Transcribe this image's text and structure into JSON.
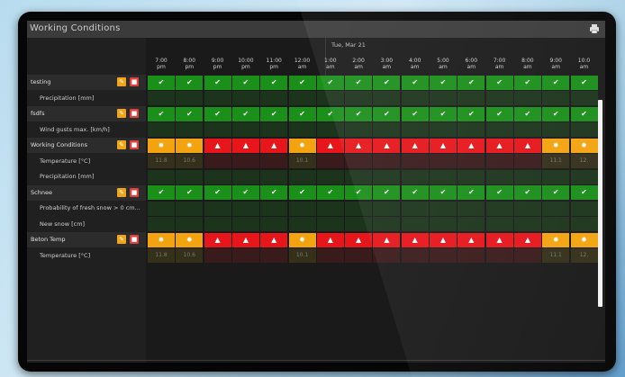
{
  "window": {
    "title": "Working Conditions",
    "print_icon": "printer-icon"
  },
  "date_label": "Tue, Mar 21",
  "hours": [
    {
      "t": "7:00",
      "p": "pm"
    },
    {
      "t": "8:00",
      "p": "pm"
    },
    {
      "t": "9:00",
      "p": "pm"
    },
    {
      "t": "10:00",
      "p": "pm"
    },
    {
      "t": "11:00",
      "p": "pm"
    },
    {
      "t": "12:00",
      "p": "am"
    },
    {
      "t": "1:00",
      "p": "am"
    },
    {
      "t": "2:00",
      "p": "am"
    },
    {
      "t": "3:00",
      "p": "am"
    },
    {
      "t": "4:00",
      "p": "am"
    },
    {
      "t": "5:00",
      "p": "am"
    },
    {
      "t": "6:00",
      "p": "am"
    },
    {
      "t": "7:00",
      "p": "am"
    },
    {
      "t": "8:00",
      "p": "am"
    },
    {
      "t": "9:00",
      "p": "am"
    },
    {
      "t": "10:0",
      "p": "am"
    }
  ],
  "rows": [
    {
      "kind": "head",
      "label": "testing",
      "cells": [
        "g",
        "g",
        "g",
        "g",
        "g",
        "g",
        "g",
        "g",
        "g",
        "g",
        "g",
        "g",
        "g",
        "g",
        "g",
        "g"
      ]
    },
    {
      "kind": "sub",
      "label": "Precipitation [mm]",
      "cells": [
        "dg",
        "dg",
        "dg",
        "dg",
        "dg",
        "dg",
        "dg",
        "dg",
        "dg",
        "dg",
        "dg",
        "dg",
        "dg",
        "dg",
        "dg",
        "dg"
      ],
      "values": [
        "",
        "",
        "",
        "",
        "",
        "",
        "",
        "",
        "",
        "",
        "",
        "",
        "",
        "",
        "",
        ""
      ]
    },
    {
      "kind": "head",
      "label": "fsdfs",
      "cells": [
        "g",
        "g",
        "g",
        "g",
        "g",
        "g",
        "g",
        "g",
        "g",
        "g",
        "g",
        "g",
        "g",
        "g",
        "g",
        "g"
      ]
    },
    {
      "kind": "sub",
      "label": "Wind gusts max. [km/h]",
      "cells": [
        "dg",
        "dg",
        "dg",
        "dg",
        "dg",
        "dg",
        "dg",
        "dg",
        "dg",
        "dg",
        "dg",
        "dg",
        "dg",
        "dg",
        "dg",
        "dg"
      ],
      "values": [
        "",
        "",
        "",
        "",
        "",
        "",
        "",
        "",
        "",
        "",
        "",
        "",
        "",
        "",
        "",
        ""
      ]
    },
    {
      "kind": "head",
      "label": "Working Conditions",
      "cells": [
        "o",
        "o",
        "r",
        "r",
        "r",
        "o",
        "r",
        "r",
        "r",
        "r",
        "r",
        "r",
        "r",
        "r",
        "o",
        "o"
      ]
    },
    {
      "kind": "sub",
      "label": "Temperature [°C]",
      "cells": [
        "dy",
        "dy",
        "dr",
        "dr",
        "dr",
        "dy",
        "dr",
        "dr",
        "dr",
        "dr",
        "dr",
        "dr",
        "dr",
        "dr",
        "dy",
        "dy"
      ],
      "values": [
        "11.8",
        "10.6",
        "",
        "",
        "",
        "10.1",
        "",
        "",
        "",
        "",
        "",
        "",
        "",
        "",
        "11.1",
        "12."
      ]
    },
    {
      "kind": "sub",
      "label": "Precipitation [mm]",
      "cells": [
        "dg",
        "dg",
        "dg",
        "dg",
        "dg",
        "dg",
        "dg",
        "dg",
        "dg",
        "dg",
        "dg",
        "dg",
        "dg",
        "dg",
        "dg",
        "dg"
      ],
      "values": [
        "",
        "",
        "",
        "",
        "",
        "",
        "",
        "",
        "",
        "",
        "",
        "",
        "",
        "",
        "",
        ""
      ]
    },
    {
      "kind": "head",
      "label": "Schnee",
      "cells": [
        "g",
        "g",
        "g",
        "g",
        "g",
        "g",
        "g",
        "g",
        "g",
        "g",
        "g",
        "g",
        "g",
        "g",
        "g",
        "g"
      ]
    },
    {
      "kind": "sub",
      "label": "Probability of fresh snow > 0 cm...",
      "cells": [
        "dg",
        "dg",
        "dg",
        "dg",
        "dg",
        "dg",
        "dg",
        "dg",
        "dg",
        "dg",
        "dg",
        "dg",
        "dg",
        "dg",
        "dg",
        "dg"
      ],
      "values": [
        "",
        "",
        "",
        "",
        "",
        "",
        "",
        "",
        "",
        "",
        "",
        "",
        "",
        "",
        "",
        ""
      ]
    },
    {
      "kind": "sub",
      "label": "New snow [cm]",
      "cells": [
        "dg",
        "dg",
        "dg",
        "dg",
        "dg",
        "dg",
        "dg",
        "dg",
        "dg",
        "dg",
        "dg",
        "dg",
        "dg",
        "dg",
        "dg",
        "dg"
      ],
      "values": [
        "",
        "",
        "",
        "",
        "",
        "",
        "",
        "",
        "",
        "",
        "",
        "",
        "",
        "",
        "",
        ""
      ]
    },
    {
      "kind": "head",
      "label": "Beton Temp",
      "cells": [
        "o",
        "o",
        "r",
        "r",
        "r",
        "o",
        "r",
        "r",
        "r",
        "r",
        "r",
        "r",
        "r",
        "r",
        "o",
        "o"
      ]
    },
    {
      "kind": "sub",
      "label": "Temperature [°C]",
      "cells": [
        "dy",
        "dy",
        "dr",
        "dr",
        "dr",
        "dy",
        "dr",
        "dr",
        "dr",
        "dr",
        "dr",
        "dr",
        "dr",
        "dr",
        "dy",
        "dy"
      ],
      "values": [
        "11.8",
        "10.6",
        "",
        "",
        "",
        "10.1",
        "",
        "",
        "",
        "",
        "",
        "",
        "",
        "",
        "11.1",
        "12."
      ]
    }
  ],
  "colors": {
    "green": "#1a8f1a",
    "orange": "#f3a30f",
    "red": "#e6161b"
  },
  "icons": {
    "g": "check-icon",
    "o": "sun-icon",
    "r": "warning-icon",
    "edit": "edit-icon",
    "delete": "delete-icon"
  }
}
